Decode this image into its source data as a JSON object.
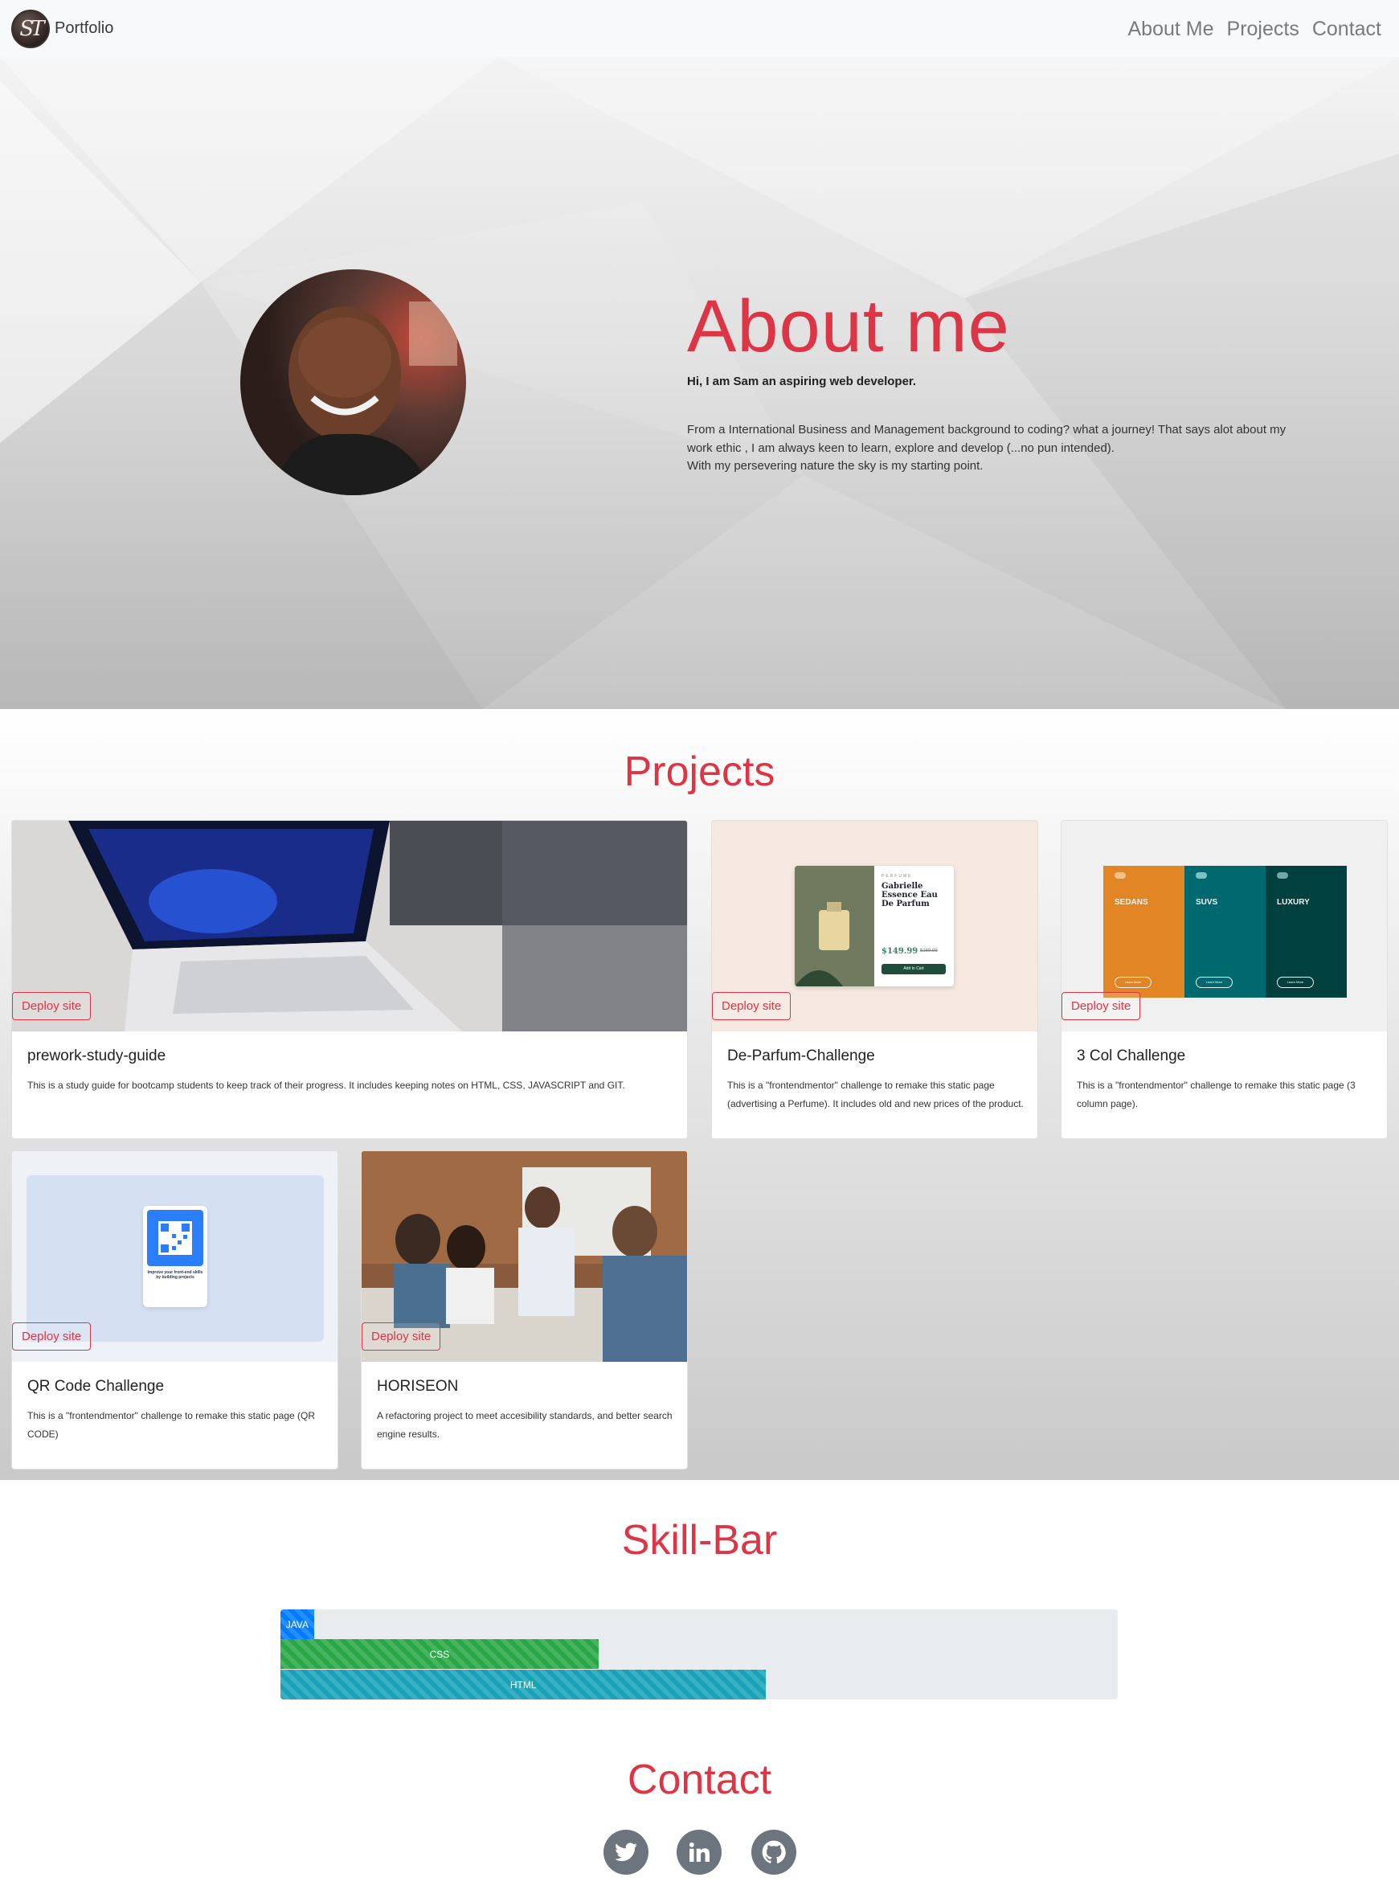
{
  "nav": {
    "logo_text": "ST",
    "brand": "Portfolio",
    "links": [
      "About Me",
      "Projects",
      "Contact"
    ]
  },
  "hero": {
    "title": "About me",
    "subtitle": "Hi, I am Sam an aspiring web developer.",
    "body": [
      "From a International Business and Management background to coding? what a journey! That says alot about my",
      "work ethic , I am always keen to learn, explore and develop (...no pun intended).",
      "With my persevering nature the sky is my starting point."
    ]
  },
  "projects": {
    "title": "Projects",
    "deploy_label": "Deploy site",
    "cards": [
      {
        "title": "prework-study-guide",
        "text": "This is a study guide for bootcamp students to keep track of their progress. It includes keeping notes on HTML, CSS, JAVASCRIPT and GIT."
      },
      {
        "title": "De-Parfum-Challenge",
        "text": "This is a \"frontendmentor\" challenge to remake this static page (advertising a Perfume). It includes old and new prices of the product."
      },
      {
        "title": "3 Col Challenge",
        "text": "This is a \"frontendmentor\" challenge to remake this static page (3 column page)."
      },
      {
        "title": "QR Code Challenge",
        "text": "This is a \"frontendmentor\" challenge to remake this static page (QR CODE)"
      },
      {
        "title": "HORISEON",
        "text": "A refactoring project to meet accesibility standards, and better search engine results."
      }
    ],
    "perfume": {
      "kicker": "PERFUME",
      "name": "Gabrielle Essence Eau De Parfum",
      "price": "$149.99",
      "old_price": "$169.99",
      "cta": "Add to Cart"
    },
    "columns": {
      "labels": [
        "SEDANS",
        "SUVS",
        "LUXURY"
      ],
      "button": "Learn More"
    },
    "qr": {
      "caption": "Improve your front-end skills by building projects"
    }
  },
  "skills": {
    "title": "Skill-Bar",
    "bars": [
      {
        "label": "JAVA",
        "percent": 4,
        "color": "#007bff"
      },
      {
        "label": "CSS",
        "percent": 38,
        "color": "#28a745"
      },
      {
        "label": "HTML",
        "percent": 58,
        "color": "#17a2b8"
      }
    ]
  },
  "contact": {
    "title": "Contact",
    "icons": [
      "twitter-icon",
      "linkedin-icon",
      "github-icon"
    ]
  }
}
